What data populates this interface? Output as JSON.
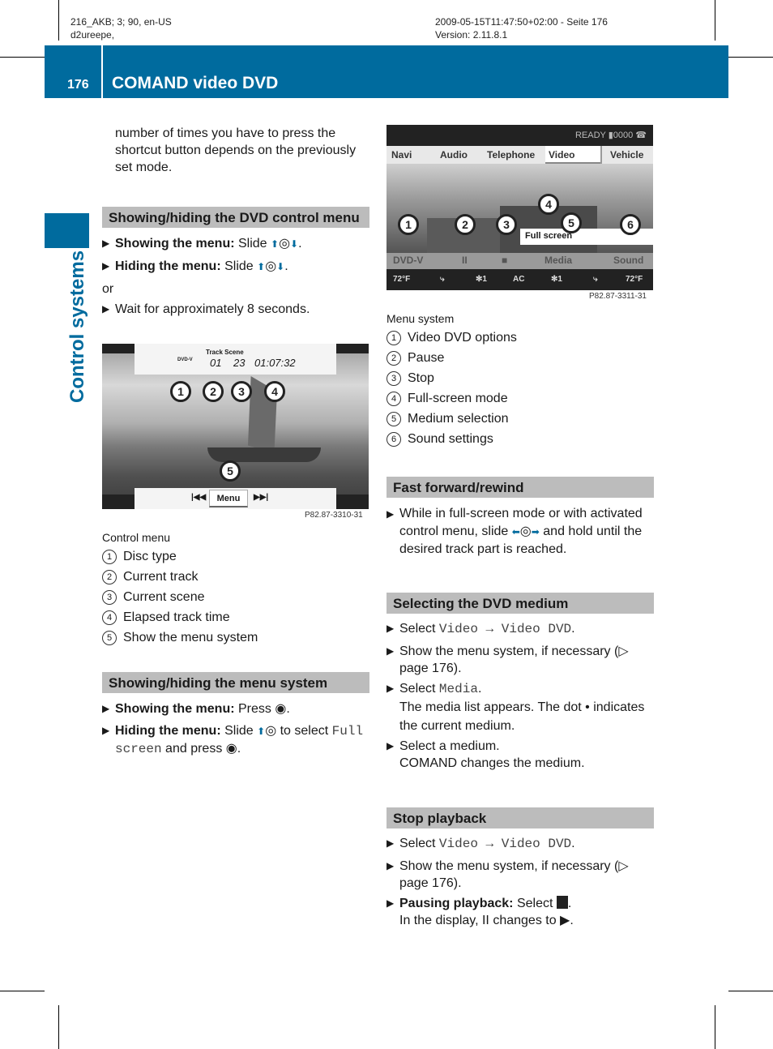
{
  "meta": {
    "left_line1": "216_AKB; 3; 90, en-US",
    "left_line2": "d2ureepe,",
    "right_line1": "2009-05-15T11:47:50+02:00 - Seite 176",
    "right_line2": "Version: 2.11.8.1"
  },
  "header": {
    "page_number": "176",
    "title": "COMAND video DVD"
  },
  "side_label": "Control systems",
  "left": {
    "intro": "number of times you have to press the shortcut button depends on the previously set mode.",
    "sec1": {
      "heading": "Showing/hiding the DVD control menu",
      "b1_bold": "Showing the menu:",
      "b1_text": " Slide ",
      "b2_bold": "Hiding the menu:",
      "b2_text": " Slide ",
      "or": "or",
      "b3": "Wait for approximately 8 seconds."
    },
    "figure1": {
      "track_scene_label": "Track Scene",
      "disc": "DVD-V",
      "track": "01",
      "scene": "23",
      "time": "01:07:32",
      "menu_button": "Menu",
      "prev": "|◀◀",
      "next": "▶▶|",
      "ref": "P82.87-3310-31",
      "callouts": [
        "1",
        "2",
        "3",
        "4",
        "5"
      ]
    },
    "caption1": "Control menu",
    "list1": [
      "Disc type",
      "Current track",
      "Current scene",
      "Elapsed track time",
      "Show the menu system"
    ],
    "sec2": {
      "heading": "Showing/hiding the menu system",
      "b1_bold": "Showing the menu:",
      "b1_text": " Press ",
      "b2_bold": "Hiding the menu:",
      "b2_text": " Slide ",
      "b2_text2": " to select ",
      "b2_mono": "Full screen",
      "b2_text3": " and press "
    }
  },
  "right": {
    "figure2": {
      "status": "READY ▮0000",
      "tabs": [
        "Navi",
        "Audio",
        "Telephone",
        "Video",
        "Vehicle"
      ],
      "active_tab": "Video",
      "full_screen": "Full screen",
      "menu_items": [
        "DVD-V",
        "II",
        "■",
        "Media",
        "Sound"
      ],
      "climate": [
        "72°F",
        "⤷",
        "✻1",
        "AC",
        "✻1",
        "⤷",
        "72°F"
      ],
      "ref": "P82.87-3311-31",
      "callouts": [
        "1",
        "2",
        "3",
        "4",
        "5",
        "6"
      ]
    },
    "caption2": "Menu system",
    "list2": [
      "Video DVD options",
      "Pause",
      "Stop",
      "Full-screen mode",
      "Medium selection",
      "Sound settings"
    ],
    "sec3": {
      "heading": "Fast forward/rewind",
      "b1_a": "While in full-screen mode or with activated control menu, slide ",
      "b1_b": " and hold until the desired track part is reached."
    },
    "sec4": {
      "heading": "Selecting the DVD medium",
      "b1_text": "Select ",
      "b1_mono": "Video → Video DVD",
      "b1_end": ".",
      "b2": "Show the menu system, if necessary (▷ page 176).",
      "b3_text": "Select ",
      "b3_mono": "Media",
      "b3_end": ".",
      "b3_sub": "The media list appears. The dot  •  indicates the current medium.",
      "b4": "Select a medium.",
      "b4_sub": "COMAND changes the medium."
    },
    "sec5": {
      "heading": "Stop playback",
      "b1_text": "Select ",
      "b1_mono": "Video → Video DVD",
      "b1_end": ".",
      "b2": "Show the menu system, if necessary (▷ page 176).",
      "b3_bold": "Pausing playback:",
      "b3_text": " Select ",
      "b3_end": ".",
      "b3_sub": "In the display, II changes to ▶."
    }
  },
  "colors": {
    "brand": "#006b9e",
    "heading_bg": "#bcbcbc"
  }
}
